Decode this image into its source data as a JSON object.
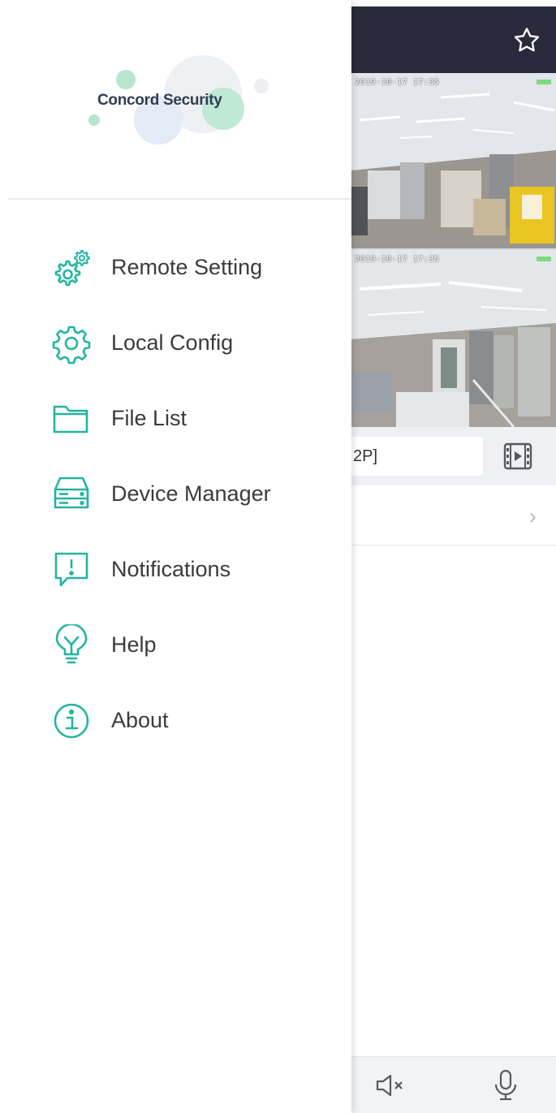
{
  "drawer": {
    "logo_text": "Concord Security",
    "menu": [
      {
        "id": "remote-setting",
        "label": "Remote Setting",
        "icon": "gears-icon"
      },
      {
        "id": "local-config",
        "label": "Local Config",
        "icon": "gear-icon"
      },
      {
        "id": "file-list",
        "label": "File List",
        "icon": "folder-icon"
      },
      {
        "id": "device-manager",
        "label": "Device Manager",
        "icon": "server-icon"
      },
      {
        "id": "notifications",
        "label": "Notifications",
        "icon": "alert-bubble-icon"
      },
      {
        "id": "help",
        "label": "Help",
        "icon": "lightbulb-icon"
      },
      {
        "id": "about",
        "label": "About",
        "icon": "info-icon"
      }
    ]
  },
  "background": {
    "camera_1_timestamp": "2019-10-17 17:35",
    "camera_2_timestamp": "2019-10-17 17:35",
    "channel_input_value": "2P]",
    "icons": [
      "star-icon",
      "film-play-icon",
      "chevron-right-icon",
      "speaker-mute-icon",
      "microphone-icon"
    ]
  },
  "colors": {
    "accent": "#22b5a0",
    "topbar": "#2b2a3c",
    "menu_text": "#3b3b3b",
    "logo_text": "#2f3e51"
  }
}
